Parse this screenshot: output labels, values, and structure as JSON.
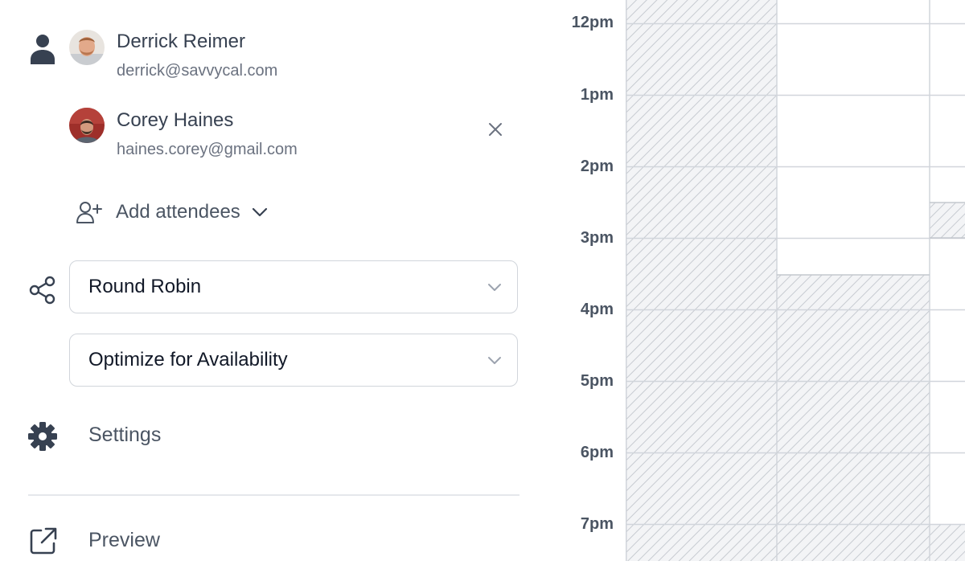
{
  "attendees": [
    {
      "name": "Derrick Reimer",
      "email": "derrick@savvycal.com",
      "removable": false,
      "avatar": "avatar-derrick"
    },
    {
      "name": "Corey Haines",
      "email": "haines.corey@gmail.com",
      "removable": true,
      "avatar": "avatar-corey"
    }
  ],
  "add_attendees": {
    "label": "Add attendees",
    "icon": "user-plus-icon"
  },
  "scheduling": {
    "icon": "share-icon",
    "method": "Round Robin",
    "priority": "Optimize for Availability"
  },
  "menu": {
    "settings_label": "Settings",
    "settings_icon": "gear-icon",
    "preview_label": "Preview",
    "preview_icon": "external-link-icon"
  },
  "calendar": {
    "time_labels": [
      "12pm",
      "1pm",
      "2pm",
      "3pm",
      "4pm",
      "5pm",
      "6pm",
      "7pm"
    ],
    "colors": {
      "grid": "#d1d5db",
      "hatch": "#c7cbd1",
      "hatch_bg": "#f3f4f6"
    }
  }
}
